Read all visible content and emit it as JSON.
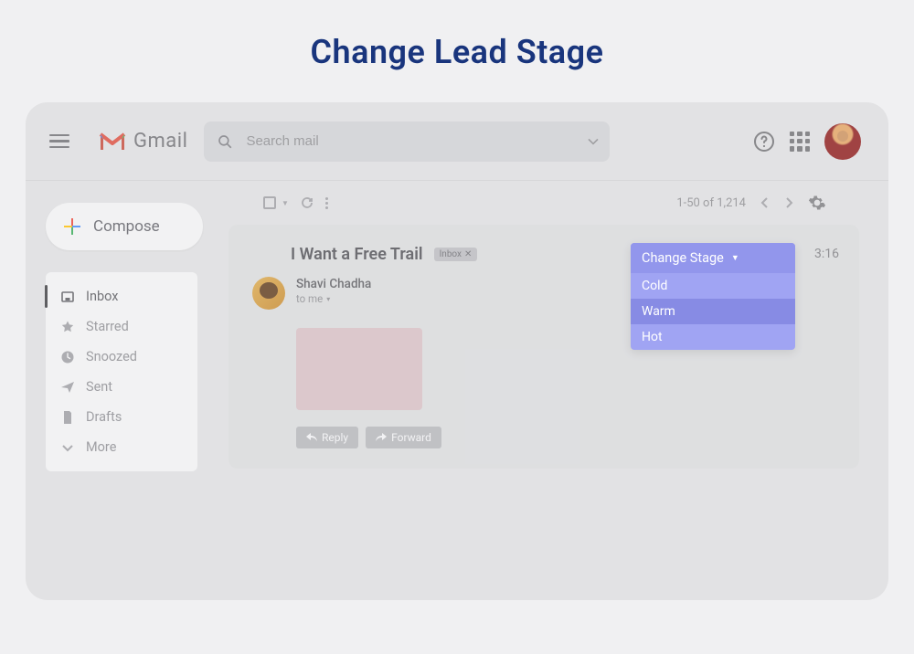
{
  "page_title": "Change Lead Stage",
  "logo_text": "Gmail",
  "search": {
    "placeholder": "Search mail"
  },
  "compose_label": "Compose",
  "folders": [
    {
      "label": "Inbox",
      "active": true
    },
    {
      "label": "Starred"
    },
    {
      "label": "Snoozed"
    },
    {
      "label": "Sent"
    },
    {
      "label": "Drafts"
    },
    {
      "label": "More"
    }
  ],
  "toolbar": {
    "pagination": "1-50 of 1,214"
  },
  "message": {
    "subject": "I Want a Free Trail",
    "inbox_pill": "Inbox",
    "sender_name": "Shavi Chadha",
    "to_me": "to me",
    "time": "3:16",
    "reply_label": "Reply",
    "forward_label": "Forward"
  },
  "stage_dropdown": {
    "header": "Change Stage",
    "options": [
      {
        "label": "Cold",
        "selected": false
      },
      {
        "label": "Warm",
        "selected": true
      },
      {
        "label": "Hot",
        "selected": false
      }
    ]
  }
}
